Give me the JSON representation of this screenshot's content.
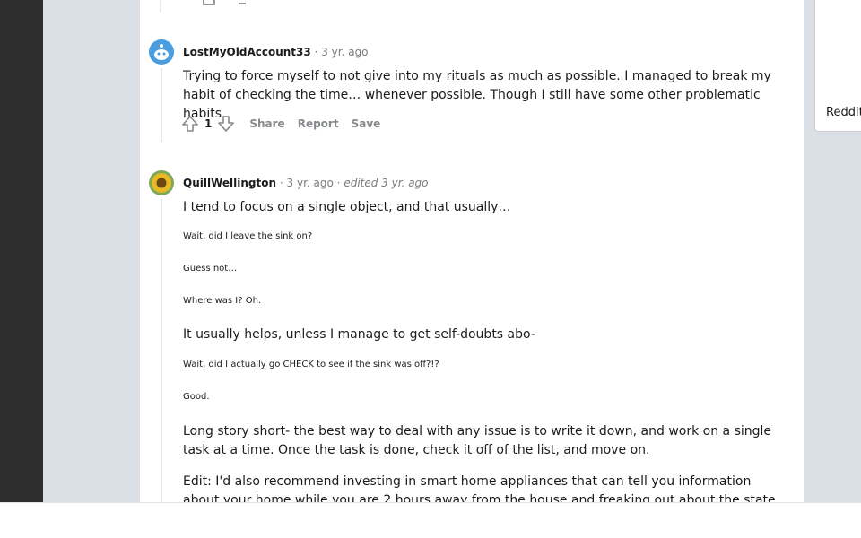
{
  "comments": [
    {
      "username": "LostMyOldAccount33",
      "time": "3 yr. ago",
      "paragraphs": [
        "Trying to force myself to not give into my rituals as much as possible. I managed to break my habit of checking the time… whenever possible. Though I still have some other problematic habits."
      ],
      "votes": "1",
      "actions": [
        "Share",
        "Report",
        "Save"
      ]
    },
    {
      "username": "QuillWellington",
      "time": "3 yr. ago",
      "edited": "edited 3 yr. ago",
      "p1": "I tend to focus on a single object, and that usually…",
      "s1": "Wait, did I leave the sink on?",
      "s2": "Guess not…",
      "s3": "Where was I? Oh.",
      "p2": "It usually helps, unless I manage to get self-doubts abo-",
      "s4": "Wait, did I actually go CHECK to see if the sink was off?!?",
      "s5": "Good.",
      "p3": "Long story short- the best way to deal with any issue is to write it down, and work on a single task at a time. Once the task is done, check it off of the list, and move on.",
      "p4": "Edit: I'd also recommend investing in smart home appliances that can tell you information about your home while you are 2 hours away from the house and freaking out about the state of"
    }
  ],
  "sidebar": {
    "label": "Reddit"
  },
  "separator": "·",
  "colors": {
    "dark": "#2d2d2d",
    "page_bg": "#dae0e6",
    "card": "#ffffff",
    "avatar_blue": "#4a9ee0"
  }
}
